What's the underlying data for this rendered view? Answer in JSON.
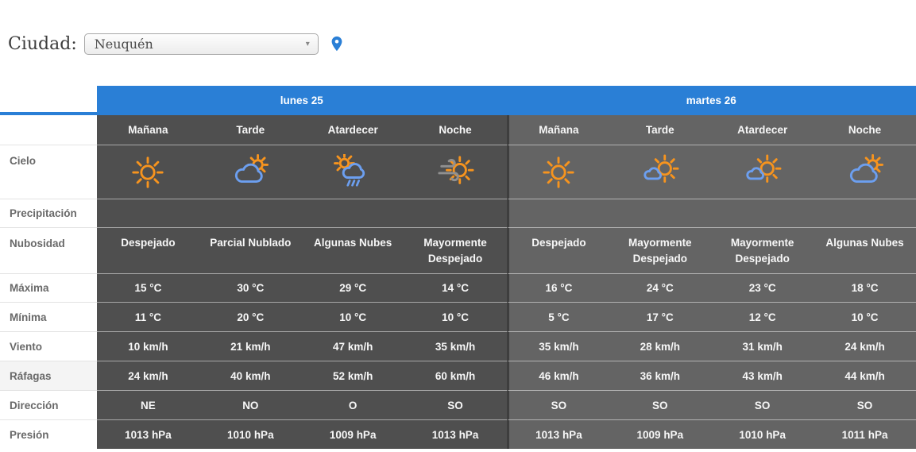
{
  "city_selector": {
    "label": "Ciudad:",
    "selected_city": "Neuquén"
  },
  "colors": {
    "accent_blue": "#2a7fd6",
    "day1_cell_gray": "#4f4f4f",
    "day2_cell_gray": "#646464",
    "sun_orange": "#f7941e",
    "cloud_blue": "#6c9ff0"
  },
  "table": {
    "day_headers": [
      "lunes 25",
      "martes 26"
    ],
    "period_headers": [
      "Mañana",
      "Tarde",
      "Atardecer",
      "Noche",
      "Mañana",
      "Tarde",
      "Atardecer",
      "Noche"
    ],
    "rows": [
      {
        "label": "Cielo",
        "icons": [
          "sunny",
          "partly-cloudy",
          "rain-showers-sun",
          "windy-sun",
          "sunny",
          "mostly-sunny",
          "mostly-sunny",
          "partly-cloudy"
        ]
      },
      {
        "label": "Precipitación",
        "values": [
          "",
          "",
          "",
          "",
          "",
          "",
          "",
          ""
        ]
      },
      {
        "label": "Nubosidad",
        "values": [
          "Despejado",
          "Parcial Nublado",
          "Algunas Nubes",
          "Mayormente Despejado",
          "Despejado",
          "Mayormente Despejado",
          "Mayormente Despejado",
          "Algunas Nubes"
        ]
      },
      {
        "label": "Máxima",
        "values": [
          "15 °C",
          "30 °C",
          "29 °C",
          "14 °C",
          "16 °C",
          "24 °C",
          "23 °C",
          "18 °C"
        ]
      },
      {
        "label": "Mínima",
        "values": [
          "11 °C",
          "20 °C",
          "10 °C",
          "10 °C",
          "5 °C",
          "17 °C",
          "12 °C",
          "10 °C"
        ]
      },
      {
        "label": "Viento",
        "values": [
          "10 km/h",
          "21 km/h",
          "47 km/h",
          "35 km/h",
          "35 km/h",
          "28 km/h",
          "31 km/h",
          "24 km/h"
        ]
      },
      {
        "label": "Ráfagas",
        "values": [
          "24 km/h",
          "40 km/h",
          "52 km/h",
          "60 km/h",
          "46 km/h",
          "36 km/h",
          "43 km/h",
          "44 km/h"
        ]
      },
      {
        "label": "Dirección",
        "values": [
          "NE",
          "NO",
          "O",
          "SO",
          "SO",
          "SO",
          "SO",
          "SO"
        ]
      },
      {
        "label": "Presión",
        "values": [
          "1013 hPa",
          "1010 hPa",
          "1009 hPa",
          "1013 hPa",
          "1013 hPa",
          "1009 hPa",
          "1010 hPa",
          "1011 hPa"
        ]
      }
    ]
  }
}
